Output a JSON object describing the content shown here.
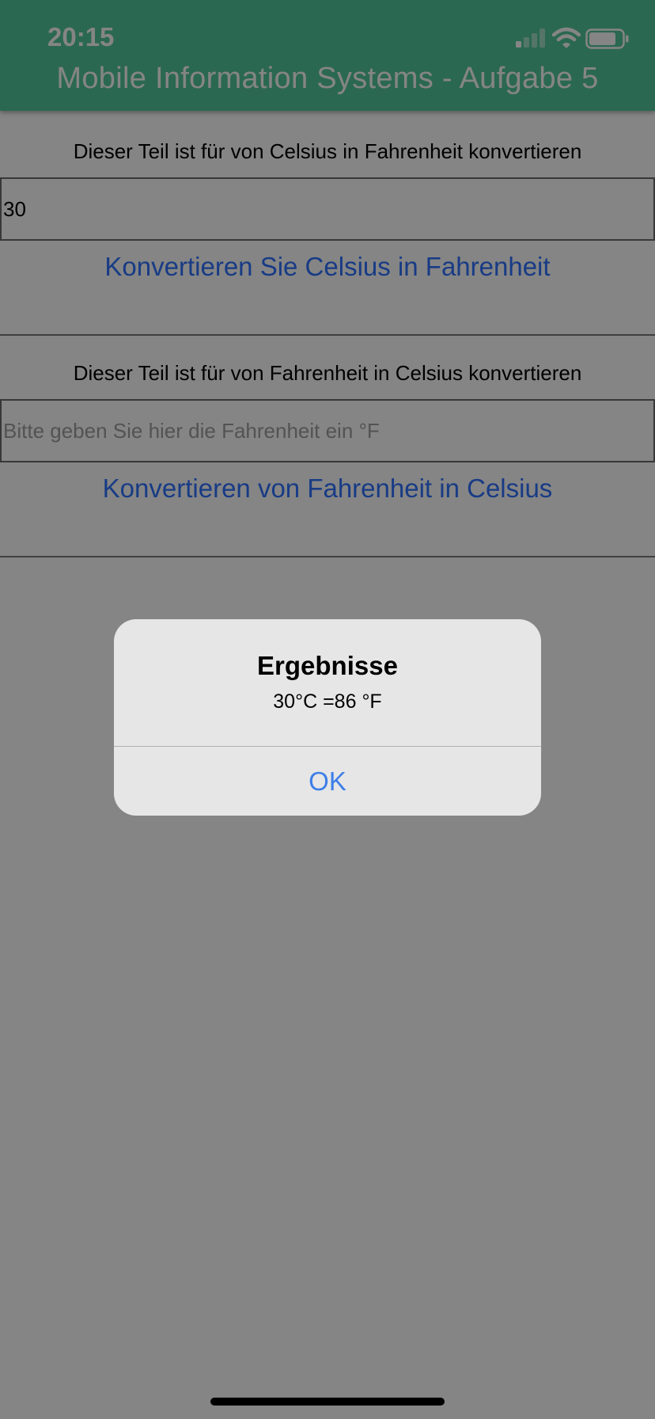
{
  "status_bar": {
    "time": "20:15",
    "icons": [
      "cellular-signal-icon",
      "wifi-icon",
      "battery-icon"
    ]
  },
  "header": {
    "title": "Mobile Information Systems - Aufgabe 5"
  },
  "celsius_section": {
    "label": "Dieser Teil ist für von Celsius in Fahrenheit konvertieren",
    "input_value": "30",
    "button_label": "Konvertieren Sie Celsius in Fahrenheit"
  },
  "fahrenheit_section": {
    "label": "Dieser Teil ist für von Fahrenheit in Celsius konvertieren",
    "input_value": "",
    "input_placeholder": "Bitte geben Sie hier die Fahrenheit ein °F",
    "button_label": "Konvertieren von Fahrenheit in Celsius"
  },
  "alert": {
    "title": "Ergebnisse",
    "message": "30°C =86 °F",
    "ok_label": "OK"
  },
  "colors": {
    "header": "#54c89b",
    "link": "#2f72ff",
    "alert_button": "#3d7ee8"
  }
}
